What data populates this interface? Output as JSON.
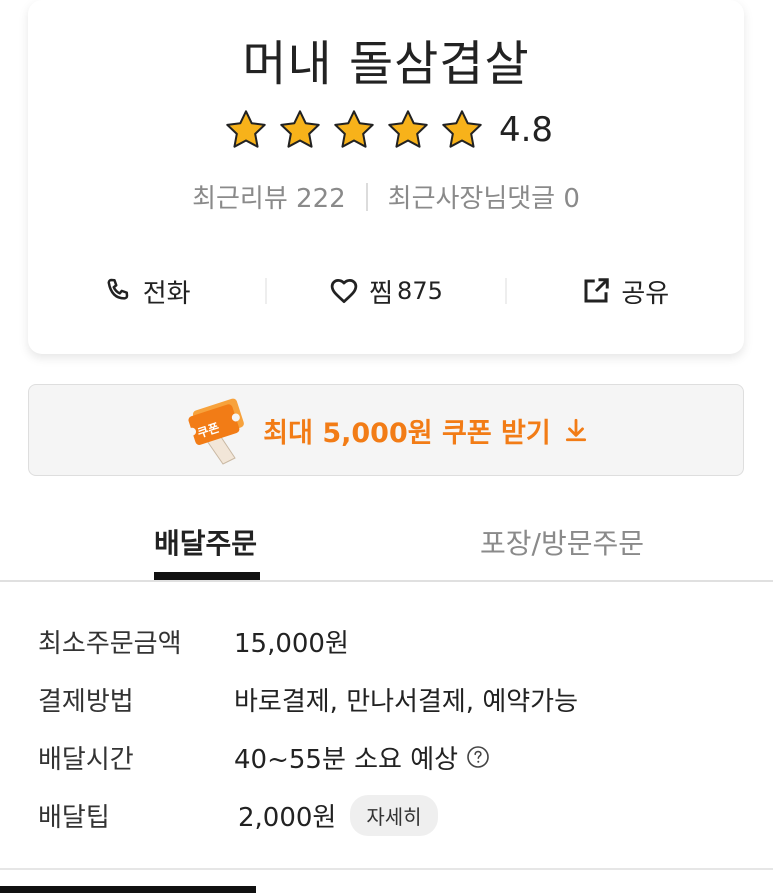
{
  "store": {
    "name": "머내 돌삼겹살",
    "rating": "4.8",
    "stars_filled": 5,
    "recent_reviews": "최근리뷰 222",
    "recent_owner_replies": "최근사장님댓글 0"
  },
  "actions": {
    "call_label": "전화",
    "like_label": "찜",
    "like_count": "875",
    "share_label": "공유"
  },
  "coupon": {
    "badge_text": "쿠폰",
    "label": "최대 5,000원 쿠폰 받기"
  },
  "tabs": {
    "delivery": "배달주문",
    "pickup": "포장/방문주문",
    "active": "delivery"
  },
  "info": {
    "min_order_label": "최소주문금액",
    "min_order_value": "15,000원",
    "payment_label": "결제방법",
    "payment_value": "바로결제, 만나서결제, 예약가능",
    "delivery_time_label": "배달시간",
    "delivery_time_value": "40~55분 소요 예상",
    "delivery_tip_label": "배달팁",
    "delivery_tip_value": "2,000원",
    "detail_button": "자세히"
  },
  "colors": {
    "accent_orange": "#f27c16",
    "star_fill": "#f7b21a",
    "muted_text": "#8a8a8a"
  }
}
